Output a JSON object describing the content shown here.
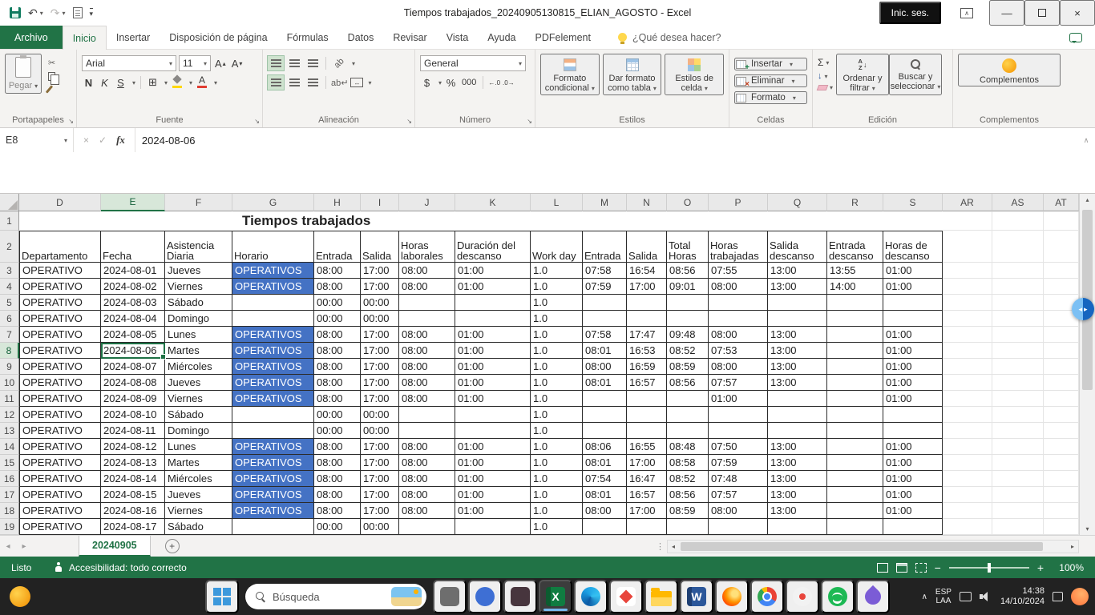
{
  "title_bar": {
    "title": "Tiempos trabajados_20240905130815_ELIAN_AGOSTO  -  Excel",
    "sign_in": "Inic. ses."
  },
  "ribbon": {
    "tabs": [
      "Archivo",
      "Inicio",
      "Insertar",
      "Disposición de página",
      "Fórmulas",
      "Datos",
      "Revisar",
      "Vista",
      "Ayuda",
      "PDFelement"
    ],
    "tell_me": "¿Qué desea hacer?",
    "clipboard": {
      "paste": "Pegar",
      "label": "Portapapeles"
    },
    "font": {
      "name": "Arial",
      "size": "11",
      "bold": "N",
      "italic": "K",
      "underline": "S",
      "label": "Fuente"
    },
    "alignment": {
      "wrap_text": "ab",
      "label": "Alineación"
    },
    "number": {
      "format": "General",
      "currency": "$",
      "percent": "%",
      "thousands": "000",
      "label": "Número"
    },
    "styles": {
      "conditional": "Formato condicional",
      "format_table": "Dar formato como tabla",
      "cell_styles": "Estilos de celda",
      "label": "Estilos"
    },
    "cells": {
      "insert": "Insertar",
      "delete": "Eliminar",
      "format": "Formato",
      "label": "Celdas"
    },
    "editing": {
      "autosum": "Σ",
      "sort": "Ordenar y filtrar",
      "find": "Buscar y seleccionar",
      "label": "Edición"
    },
    "addins": {
      "button": "Complementos",
      "label": "Complementos"
    }
  },
  "formula_bar": {
    "cell_ref": "E8",
    "value": "2024-08-06"
  },
  "grid": {
    "title": "Tiempos trabajados",
    "col_letters": [
      "D",
      "E",
      "F",
      "G",
      "H",
      "I",
      "J",
      "K",
      "L",
      "M",
      "N",
      "O",
      "P",
      "Q",
      "R",
      "S",
      "AR",
      "AS",
      "AT"
    ],
    "selected_col": "E",
    "selected_row": 8,
    "selected_cell": "E8",
    "headers": [
      "Departamento",
      "Fecha",
      "Asistencia Diaria",
      "Horario",
      "Entrada",
      "Salida",
      "Horas laborales",
      "Duración del descanso",
      "Work day",
      "Entrada",
      "Salida",
      "Total Horas",
      "Horas trabajadas",
      "Salida descanso",
      "Entrada descanso",
      "Horas de descanso"
    ],
    "rows": [
      [
        "OPERATIVO",
        "2024-08-01",
        "Jueves",
        "OPERATIVOS",
        "08:00",
        "17:00",
        "08:00",
        "01:00",
        "1.0",
        "07:58",
        "16:54",
        "08:56",
        "07:55",
        "13:00",
        "13:55",
        "01:00"
      ],
      [
        "OPERATIVO",
        "2024-08-02",
        "Viernes",
        "OPERATIVOS",
        "08:00",
        "17:00",
        "08:00",
        "01:00",
        "1.0",
        "07:59",
        "17:00",
        "09:01",
        "08:00",
        "13:00",
        "14:00",
        "01:00"
      ],
      [
        "OPERATIVO",
        "2024-08-03",
        "Sábado",
        "",
        "00:00",
        "00:00",
        "",
        "",
        "1.0",
        "",
        "",
        "",
        "",
        "",
        "",
        ""
      ],
      [
        "OPERATIVO",
        "2024-08-04",
        "Domingo",
        "",
        "00:00",
        "00:00",
        "",
        "",
        "1.0",
        "",
        "",
        "",
        "",
        "",
        "",
        ""
      ],
      [
        "OPERATIVO",
        "2024-08-05",
        "Lunes",
        "OPERATIVOS",
        "08:00",
        "17:00",
        "08:00",
        "01:00",
        "1.0",
        "07:58",
        "17:47",
        "09:48",
        "08:00",
        "13:00",
        "",
        "01:00"
      ],
      [
        "OPERATIVO",
        "2024-08-06",
        "Martes",
        "OPERATIVOS",
        "08:00",
        "17:00",
        "08:00",
        "01:00",
        "1.0",
        "08:01",
        "16:53",
        "08:52",
        "07:53",
        "13:00",
        "",
        "01:00"
      ],
      [
        "OPERATIVO",
        "2024-08-07",
        "Miércoles",
        "OPERATIVOS",
        "08:00",
        "17:00",
        "08:00",
        "01:00",
        "1.0",
        "08:00",
        "16:59",
        "08:59",
        "08:00",
        "13:00",
        "",
        "01:00"
      ],
      [
        "OPERATIVO",
        "2024-08-08",
        "Jueves",
        "OPERATIVOS",
        "08:00",
        "17:00",
        "08:00",
        "01:00",
        "1.0",
        "08:01",
        "16:57",
        "08:56",
        "07:57",
        "13:00",
        "",
        "01:00"
      ],
      [
        "OPERATIVO",
        "2024-08-09",
        "Viernes",
        "OPERATIVOS",
        "08:00",
        "17:00",
        "08:00",
        "01:00",
        "1.0",
        "",
        "",
        "",
        "01:00",
        "",
        "",
        "01:00"
      ],
      [
        "OPERATIVO",
        "2024-08-10",
        "Sábado",
        "",
        "00:00",
        "00:00",
        "",
        "",
        "1.0",
        "",
        "",
        "",
        "",
        "",
        "",
        ""
      ],
      [
        "OPERATIVO",
        "2024-08-11",
        "Domingo",
        "",
        "00:00",
        "00:00",
        "",
        "",
        "1.0",
        "",
        "",
        "",
        "",
        "",
        "",
        ""
      ],
      [
        "OPERATIVO",
        "2024-08-12",
        "Lunes",
        "OPERATIVOS",
        "08:00",
        "17:00",
        "08:00",
        "01:00",
        "1.0",
        "08:06",
        "16:55",
        "08:48",
        "07:50",
        "13:00",
        "",
        "01:00"
      ],
      [
        "OPERATIVO",
        "2024-08-13",
        "Martes",
        "OPERATIVOS",
        "08:00",
        "17:00",
        "08:00",
        "01:00",
        "1.0",
        "08:01",
        "17:00",
        "08:58",
        "07:59",
        "13:00",
        "",
        "01:00"
      ],
      [
        "OPERATIVO",
        "2024-08-14",
        "Miércoles",
        "OPERATIVOS",
        "08:00",
        "17:00",
        "08:00",
        "01:00",
        "1.0",
        "07:54",
        "16:47",
        "08:52",
        "07:48",
        "13:00",
        "",
        "01:00"
      ],
      [
        "OPERATIVO",
        "2024-08-15",
        "Jueves",
        "OPERATIVOS",
        "08:00",
        "17:00",
        "08:00",
        "01:00",
        "1.0",
        "08:01",
        "16:57",
        "08:56",
        "07:57",
        "13:00",
        "",
        "01:00"
      ],
      [
        "OPERATIVO",
        "2024-08-16",
        "Viernes",
        "OPERATIVOS",
        "08:00",
        "17:00",
        "08:00",
        "01:00",
        "1.0",
        "08:00",
        "17:00",
        "08:59",
        "08:00",
        "13:00",
        "",
        "01:00"
      ],
      [
        "OPERATIVO",
        "2024-08-17",
        "Sábado",
        "",
        "00:00",
        "00:00",
        "",
        "",
        "1.0",
        "",
        "",
        "",
        "",
        "",
        "",
        ""
      ]
    ]
  },
  "sheet_bar": {
    "tab": "20240905"
  },
  "status_bar": {
    "mode": "Listo",
    "accessibility": "Accesibilidad: todo correcto",
    "zoom": "100%"
  },
  "taskbar": {
    "search": "Búsqueda",
    "lang_top": "ESP",
    "lang_bottom": "LAA",
    "time": "14:38",
    "date": "14/10/2024"
  }
}
